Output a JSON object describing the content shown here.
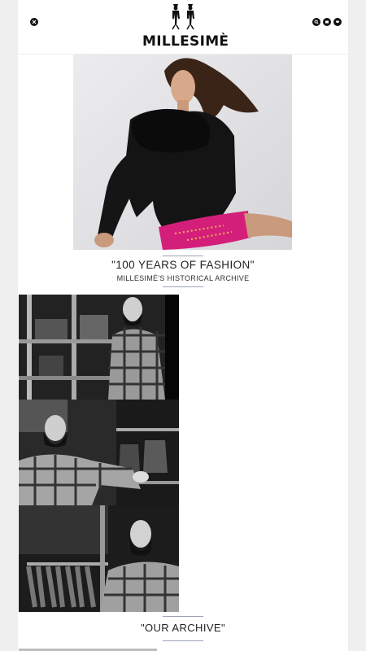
{
  "header": {
    "brand": "MILLESIMÈ",
    "icons": [
      "close-icon",
      "search-icon",
      "account-icon",
      "cart-icon"
    ]
  },
  "hero": {
    "image_desc": "fashion-model-black-fur-jacket",
    "title": "\"100 YEARS OF FASHION\"",
    "subtitle": "MILLESIMÈ'S HISTORICAL ARCHIVE"
  },
  "archive": {
    "photos": [
      "archive-photo-1",
      "archive-photo-2",
      "archive-photo-3"
    ],
    "title": "\"OUR ARCHIVE\""
  },
  "colors": {
    "accent_divider": "#9aa3b5",
    "text": "#222222",
    "background": "#ffffff"
  }
}
